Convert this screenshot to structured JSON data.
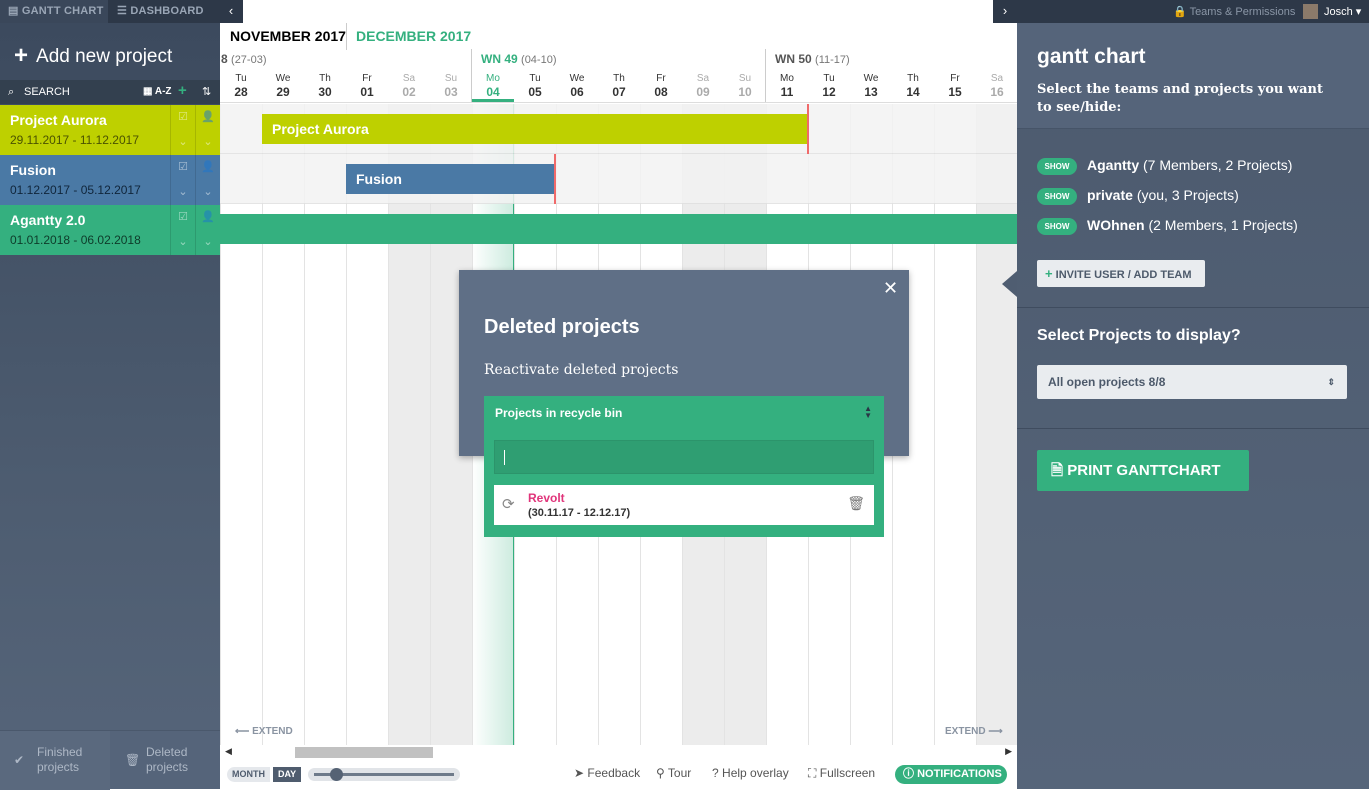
{
  "topbar": {
    "tab_gantt": "GANTT CHART",
    "tab_dashboard": "DASHBOARD",
    "teams_permissions": "Teams & Permissions",
    "user": "Josch"
  },
  "sidebar": {
    "add_project": "Add new project",
    "search": "SEARCH",
    "sort": "A-Z",
    "projects": [
      {
        "name": "Project Aurora",
        "dates": "29.11.2017 - 11.12.2017",
        "color": "#bed000"
      },
      {
        "name": "Fusion",
        "dates": "01.12.2017 - 05.12.2017",
        "color": "#4a79a5"
      },
      {
        "name": "Agantty 2.0",
        "dates": "01.01.2018 - 06.02.2018",
        "color": "#34b07f"
      }
    ],
    "finished": "Finished projects",
    "deleted": "Deleted projects"
  },
  "calendar": {
    "months": [
      "NOVEMBER 2017",
      "DECEMBER 2017"
    ],
    "weeks": [
      {
        "label": "8",
        "range": "(27-03)"
      },
      {
        "label": "WN 49",
        "range": "(04-10)"
      },
      {
        "label": "WN 50",
        "range": "(11-17)"
      }
    ],
    "days": [
      {
        "n": "Tu",
        "d": "28"
      },
      {
        "n": "We",
        "d": "29"
      },
      {
        "n": "Th",
        "d": "30"
      },
      {
        "n": "Fr",
        "d": "01"
      },
      {
        "n": "Sa",
        "d": "02"
      },
      {
        "n": "Su",
        "d": "03"
      },
      {
        "n": "Mo",
        "d": "04"
      },
      {
        "n": "Tu",
        "d": "05"
      },
      {
        "n": "We",
        "d": "06"
      },
      {
        "n": "Th",
        "d": "07"
      },
      {
        "n": "Fr",
        "d": "08"
      },
      {
        "n": "Sa",
        "d": "09"
      },
      {
        "n": "Su",
        "d": "10"
      },
      {
        "n": "Mo",
        "d": "11"
      },
      {
        "n": "Tu",
        "d": "12"
      },
      {
        "n": "We",
        "d": "13"
      },
      {
        "n": "Th",
        "d": "14"
      },
      {
        "n": "Fr",
        "d": "15"
      },
      {
        "n": "Sa",
        "d": "16"
      }
    ],
    "bars": {
      "aurora": "Project Aurora",
      "fusion": "Fusion"
    },
    "extend": "EXTEND"
  },
  "footer": {
    "month": "MONTH",
    "day": "DAY",
    "feedback": "Feedback",
    "tour": "Tour",
    "help": "Help overlay",
    "fullscreen": "Fullscreen",
    "notifications": "NOTIFICATIONS"
  },
  "right_panel": {
    "title": "gantt chart",
    "desc": "Select the teams and projects you want to see/hide:",
    "show": "SHOW",
    "teams": [
      {
        "name": "Agantty",
        "meta": "(7 Members, 2 Projects)"
      },
      {
        "name": "private",
        "meta": "(you, 3 Projects)"
      },
      {
        "name": "WOhnen",
        "meta": "(2 Members, 1 Projects)"
      }
    ],
    "invite": "INVITE USER / ADD TEAM",
    "select_title": "Select Projects to display?",
    "select_value": "All open projects 8/8",
    "print": "PRINT GANTTCHART"
  },
  "modal": {
    "title": "Deleted projects",
    "subtitle": "Reactivate deleted projects",
    "recycle_title": "Projects in recycle bin",
    "item": {
      "name": "Revolt",
      "dates": "(30.11.17 - 12.12.17)"
    }
  }
}
